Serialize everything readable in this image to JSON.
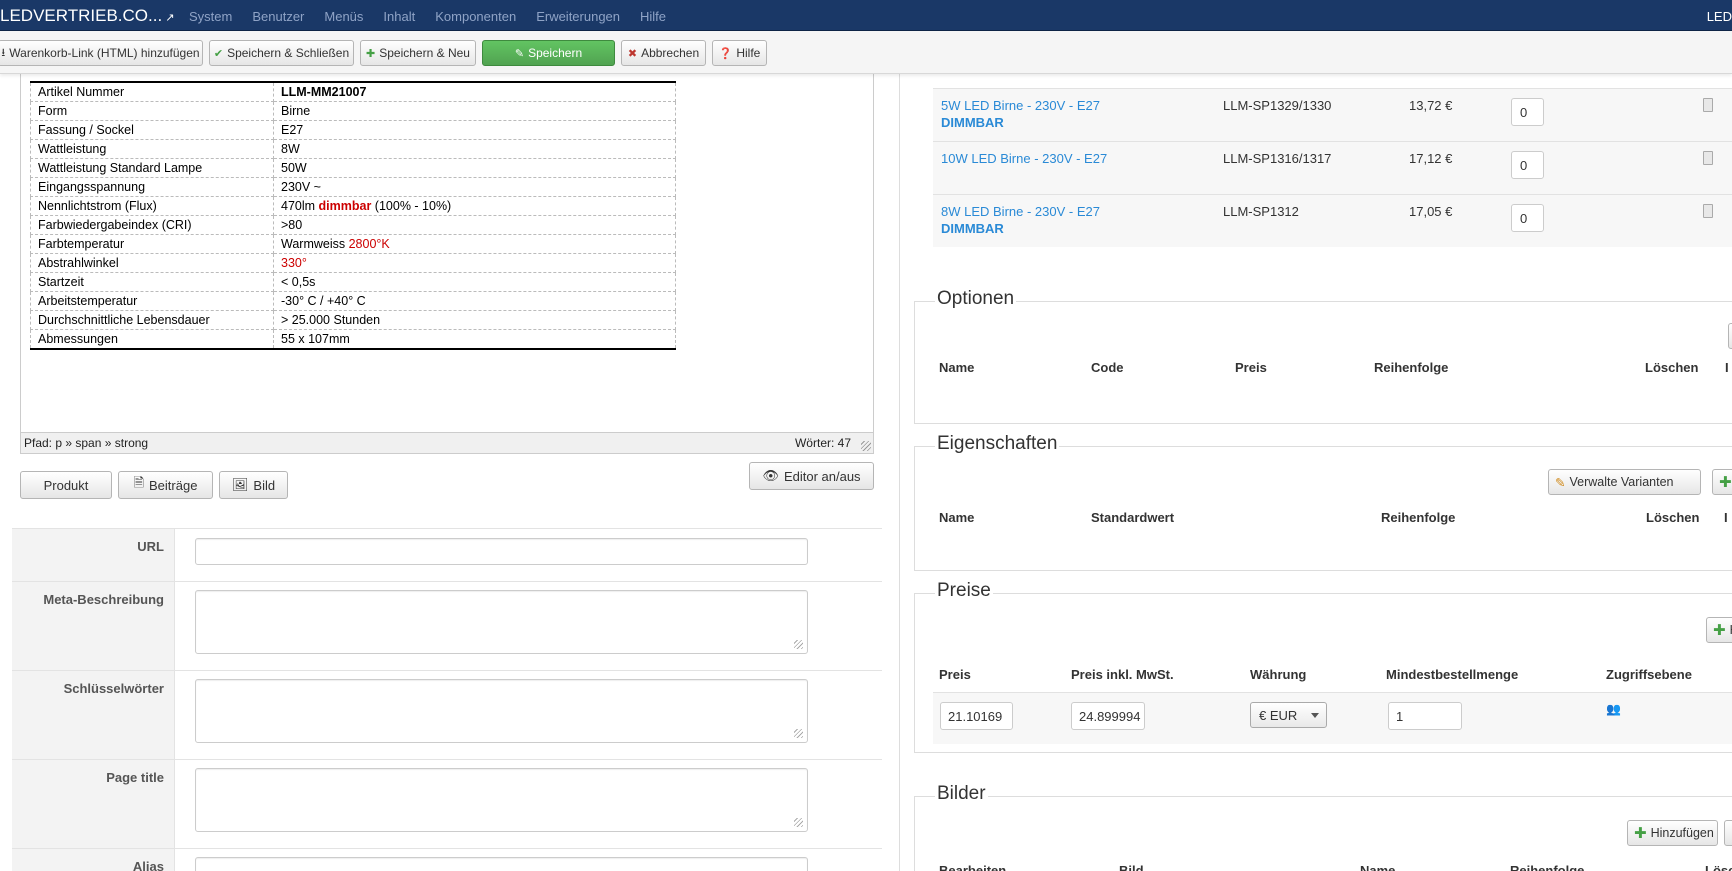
{
  "navbar": {
    "brand": "LEDVERTRIEB.CO...",
    "menu": [
      "System",
      "Benutzer",
      "Menüs",
      "Inhalt",
      "Komponenten",
      "Erweiterungen",
      "Hilfe"
    ],
    "right_text": "LED"
  },
  "toolbar": {
    "cart_link": "Warenkorb-Link (HTML) hinzufügen",
    "save_close": "Speichern & Schließen",
    "save_new": "Speichern & Neu",
    "save": "Speichern",
    "cancel": "Abbrechen",
    "help": "Hilfe"
  },
  "spec_table": [
    {
      "label": "Artikel Nummer",
      "value": "LLM-MM21007"
    },
    {
      "label": "Form",
      "value": "Birne"
    },
    {
      "label": "Fassung / Sockel",
      "value": "E27"
    },
    {
      "label": "Wattleistung",
      "value": "8W"
    },
    {
      "label": "Wattleistung Standard Lampe",
      "value": "50W"
    },
    {
      "label": "Eingangsspannung",
      "value": "230V ~"
    },
    {
      "label": "Nennlichtstrom (Flux)",
      "value_pre": "470lm ",
      "value_highlight": "dimmbar",
      "value_post": " (100% - 10%)"
    },
    {
      "label": "Farbwiedergabeindex (CRI)",
      "value": ">80"
    },
    {
      "label": "Farbtemperatur",
      "value_pre": "Warmweiss ",
      "value_red": "2800°K"
    },
    {
      "label": "Abstrahlwinkel",
      "value_red": "330°"
    },
    {
      "label": "Startzeit",
      "value": "< 0,5s"
    },
    {
      "label": "Arbeitstemperatur",
      "value": "-30° C / +40° C"
    },
    {
      "label": "Durchschnittliche Lebensdauer",
      "value": "> 25.000 Stunden"
    },
    {
      "label": "Abmessungen",
      "value": "55 x 107mm"
    }
  ],
  "editor": {
    "path": "Pfad: p » span » strong",
    "words": "Wörter: 47",
    "btn_product": "Produkt",
    "btn_articles": "Beiträge",
    "btn_image": "Bild",
    "btn_toggle": "Editor an/aus"
  },
  "form": {
    "url_label": "URL",
    "meta_label": "Meta-Beschreibung",
    "keywords_label": "Schlüsselwörter",
    "page_title_label": "Page title",
    "alias_label": "Alias"
  },
  "related_products": {
    "rows": [
      {
        "name": "5W LED Birne - 230V - E27",
        "dimmable": "DIMMBAR",
        "code": "LLM-SP1329/1330",
        "price": "13,72 €",
        "order": "0"
      },
      {
        "name": "10W LED Birne - 230V - E27",
        "dimmable": "",
        "code": "LLM-SP1316/1317",
        "price": "17,12 €",
        "order": "0"
      },
      {
        "name": "8W LED Birne - 230V - E27",
        "dimmable": "DIMMBAR",
        "code": "LLM-SP1312",
        "price": "17,05 €",
        "order": "0"
      }
    ]
  },
  "options": {
    "title": "Optionen",
    "headers": [
      "Name",
      "Code",
      "Preis",
      "Reihenfolge",
      "Löschen",
      "I"
    ]
  },
  "properties": {
    "title": "Eigenschaften",
    "manage_variants": "Verwalte Varianten",
    "headers": [
      "Name",
      "Standardwert",
      "Reihenfolge",
      "Löschen",
      "I"
    ]
  },
  "prices": {
    "title": "Preise",
    "add_btn": "H",
    "headers": [
      "Preis",
      "Preis inkl. MwSt.",
      "Währung",
      "Mindestbestellmenge",
      "Zugriffsebene"
    ],
    "price": "21.10169",
    "price_gross": "24.899994",
    "currency": "€ EUR",
    "min_qty": "1"
  },
  "images": {
    "title": "Bilder",
    "add_btn": "Hinzufügen",
    "headers": [
      "Bearbeiten",
      "Bild",
      "Name",
      "Reihenfolge",
      "Lösc"
    ]
  }
}
